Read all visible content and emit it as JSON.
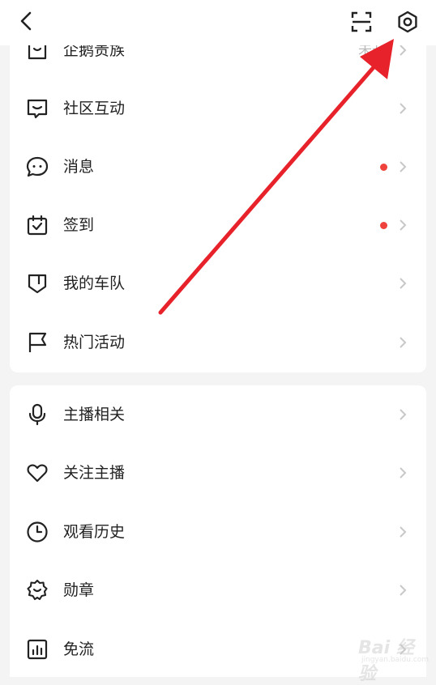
{
  "menu_group_1": [
    {
      "label": "企鹅贵族",
      "icon": "bag-icon",
      "value": "未开"
    },
    {
      "label": "社区互动",
      "icon": "chat-smile-icon"
    },
    {
      "label": "消息",
      "icon": "message-icon",
      "dot": true
    },
    {
      "label": "签到",
      "icon": "calendar-check-icon",
      "dot": true
    },
    {
      "label": "我的车队",
      "icon": "shield-icon"
    },
    {
      "label": "热门活动",
      "icon": "flag-icon"
    }
  ],
  "menu_group_2": [
    {
      "label": "主播相关",
      "icon": "microphone-icon"
    },
    {
      "label": "关注主播",
      "icon": "heart-icon"
    },
    {
      "label": "观看历史",
      "icon": "clock-icon"
    },
    {
      "label": "勋章",
      "icon": "badge-icon"
    },
    {
      "label": "免流",
      "icon": "chart-icon"
    }
  ],
  "watermark": {
    "text": "Bai 经验",
    "sub": "jingyan.baidu.com"
  },
  "colors": {
    "accent": "#f0423c",
    "arrow": "#e8222a",
    "chevron": "#c8c8c8"
  }
}
